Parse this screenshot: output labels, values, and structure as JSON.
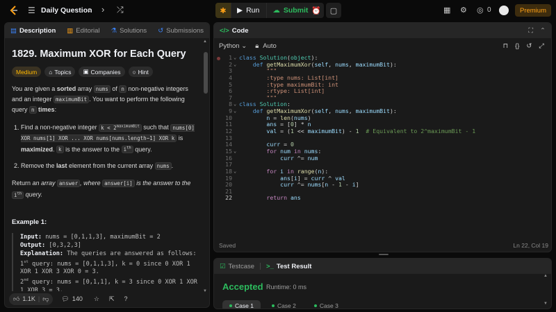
{
  "header": {
    "title": "Daily Question",
    "run_label": "Run",
    "submit_label": "Submit",
    "streak_count": "0",
    "premium_label": "Premium"
  },
  "left": {
    "tabs": [
      "Description",
      "Editorial",
      "Solutions",
      "Submissions"
    ],
    "problem_title": "1829. Maximum XOR for Each Query",
    "difficulty": "Medium",
    "chips": [
      "Topics",
      "Companies",
      "Hint"
    ],
    "p1_a": "You are given a ",
    "p1_sorted": "sorted",
    "p1_b": " array ",
    "p1_nums": "nums",
    "p1_c": " of ",
    "p1_n": "n",
    "p1_d": " non-negative integers and an integer ",
    "p1_mb": "maximumBit",
    "p1_e": ". You want to perform the following query ",
    "p1_n2": "n",
    "p1_times": "times",
    "li1_a": "Find a non-negative integer ",
    "li1_k": "k < 2",
    "li1_sup": "maximumBit",
    "li1_b": " such that ",
    "li1_expr": "nums[0] XOR nums[1] XOR ... XOR nums[nums.length−1] XOR k",
    "li1_is": " is ",
    "li1_max": "maximized",
    "li1_c": ". ",
    "li1_k2": "k",
    "li1_d": " is the answer to the ",
    "li1_i": "i",
    "li1_th": "th",
    "li1_e": " query.",
    "li2_a": "Remove the ",
    "li2_last": "last",
    "li2_b": " element from the current array ",
    "li2_nums": "nums",
    "li2_c": ".",
    "p2_a": "Return ",
    "p2_an": "an array ",
    "p2_ans": "answer",
    "p2_b": ", where ",
    "p2_ansi": "answer[i]",
    "p2_c": " is the answer to the ",
    "p2_i": "i",
    "p2_th": "th",
    "p2_d": " query.",
    "example_title": "Example 1:",
    "ex_input_label": "Input:",
    "ex_input": " nums = [0,1,1,3], maximumBit = 2",
    "ex_output_label": "Output:",
    "ex_output": " [0,3,2,3]",
    "ex_expl_label": "Explanation:",
    "ex_expl": " The queries are answered as follows:",
    "q1_a": "1",
    "q1_sup": "st",
    "q1_b": " query: nums = [0,1,1,3], k = 0 since 0 XOR 1 XOR 1 XOR 3 XOR 0 = 3.",
    "q2_a": "2",
    "q2_sup": "nd",
    "q2_b": " query: nums = [0,1,1], k = 3 since 0 XOR 1 XOR 1 XOR 3 = 3.",
    "likes": "1.1K",
    "comments": "140"
  },
  "code": {
    "tab": "Code",
    "language": "Python",
    "auto": "Auto",
    "status": "Saved",
    "cursor": "Ln 22, Col 19"
  },
  "bottom": {
    "tabs": [
      "Testcase",
      "Test Result"
    ],
    "verdict": "Accepted",
    "runtime": "Runtime: 0 ms",
    "cases": [
      "Case 1",
      "Case 2",
      "Case 3"
    ]
  }
}
